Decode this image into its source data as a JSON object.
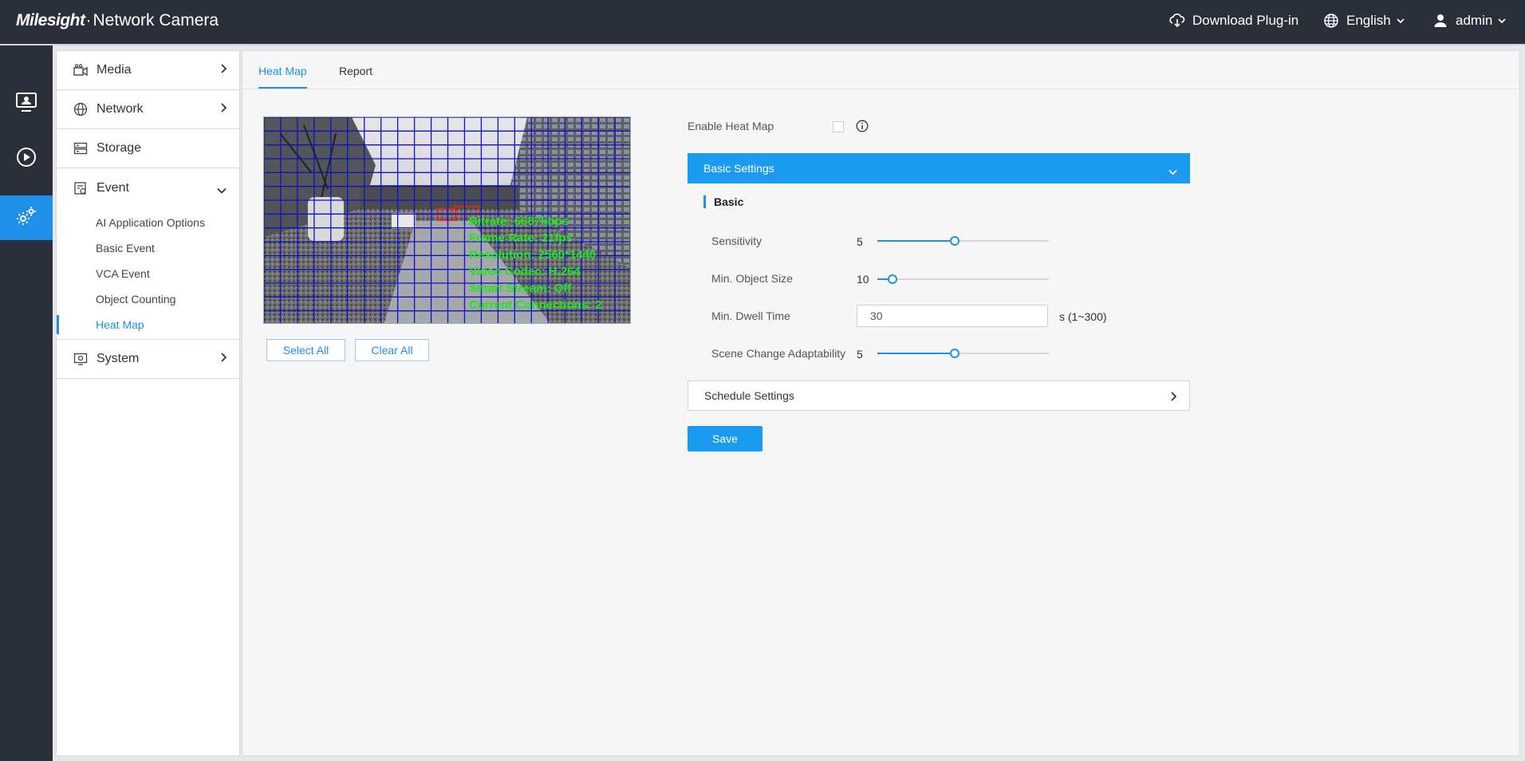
{
  "header": {
    "brand_logo": "Milesight",
    "brand_product": "Network Camera",
    "download_plugin": "Download Plug-in",
    "language": "English",
    "user": "admin"
  },
  "rail": {
    "items": [
      {
        "icon": "live-view-icon"
      },
      {
        "icon": "playback-icon"
      },
      {
        "icon": "settings-icon",
        "active": true
      }
    ]
  },
  "menu": {
    "media": "Media",
    "network": "Network",
    "storage": "Storage",
    "event": "Event",
    "event_sub": [
      "AI Application Options",
      "Basic Event",
      "VCA Event",
      "Object Counting",
      "Heat Map"
    ],
    "system": "System"
  },
  "tabs": [
    "Heat Map",
    "Report"
  ],
  "video_osd": {
    "lines": [
      "Bitrate: 6687kbps",
      "Frame Rate: 21fps",
      "Resolution: 2560*1440",
      "Video Codec: H.264",
      "Smart Stream: Off",
      "Current Connections: 2"
    ]
  },
  "grid_buttons": {
    "select_all": "Select All",
    "clear_all": "Clear All"
  },
  "form": {
    "enable_label": "Enable Heat Map",
    "enable_checked": false,
    "basic_settings": "Basic Settings",
    "basic_heading": "Basic",
    "sensitivity_label": "Sensitivity",
    "sensitivity_value": "5",
    "sensitivity_fraction": 0.45,
    "min_object_label": "Min. Object Size",
    "min_object_value": "10",
    "min_object_fraction": 0.09,
    "dwell_label": "Min. Dwell Time",
    "dwell_value": "30",
    "dwell_range": "s (1~300)",
    "scene_label": "Scene Change Adaptability",
    "scene_value": "5",
    "scene_fraction": 0.45,
    "schedule_settings": "Schedule Settings",
    "save": "Save"
  },
  "colors": {
    "accent": "#1a9bf0",
    "topbar": "#2a2f39",
    "osd_text": "#1ee81e",
    "grid": "#1010c8"
  }
}
